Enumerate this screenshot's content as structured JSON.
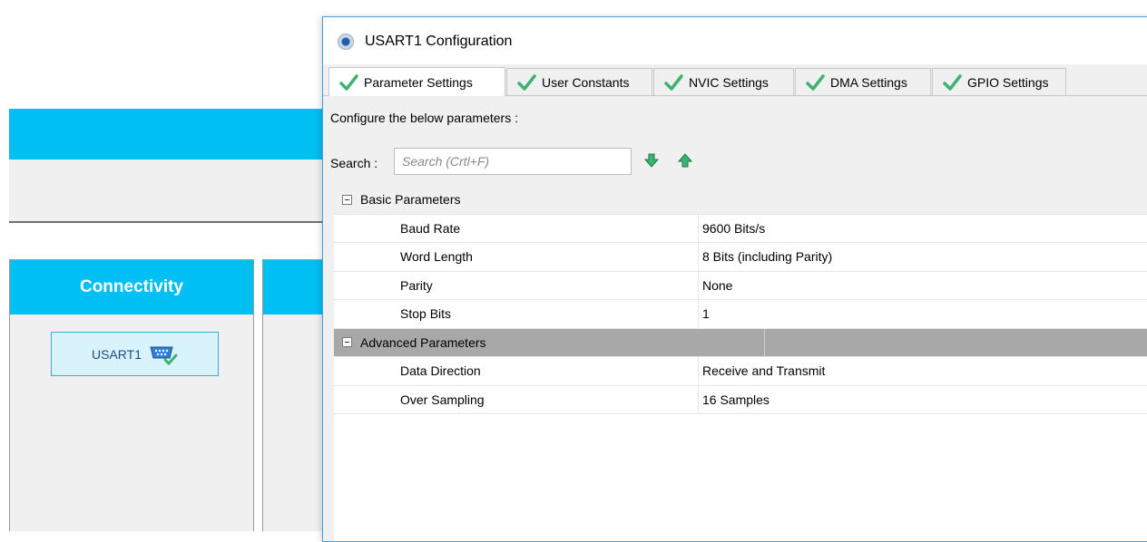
{
  "app": {
    "connectivity_header": "Connectivity",
    "usart_button_label": "USART1"
  },
  "dialog": {
    "title": "USART1 Configuration",
    "tabs": [
      {
        "label": "Parameter Settings",
        "active": true
      },
      {
        "label": "User Constants",
        "active": false
      },
      {
        "label": "NVIC Settings",
        "active": false
      },
      {
        "label": "DMA Settings",
        "active": false
      },
      {
        "label": "GPIO Settings",
        "active": false
      }
    ],
    "configure_text": "Configure the below parameters :",
    "search": {
      "label": "Search :",
      "placeholder": "Search (Crtl+F)",
      "value": ""
    },
    "sections": [
      {
        "title": "Basic Parameters",
        "params": [
          {
            "name": "Baud Rate",
            "value": "9600 Bits/s"
          },
          {
            "name": "Word Length",
            "value": "8 Bits (including Parity)"
          },
          {
            "name": "Parity",
            "value": "None"
          },
          {
            "name": "Stop Bits",
            "value": "1"
          }
        ]
      },
      {
        "title": "Advanced Parameters",
        "params": [
          {
            "name": "Data Direction",
            "value": "Receive and Transmit"
          },
          {
            "name": "Over Sampling",
            "value": "16 Samples"
          }
        ]
      }
    ]
  },
  "colors": {
    "accent": "#00bff3",
    "check_green": "#3cb371",
    "section_header": "#a8a8a8"
  },
  "icons": {
    "tab_status": "check-icon",
    "search_next": "arrow-down-icon",
    "search_prev": "arrow-up-icon",
    "usart": "serial-port-icon"
  }
}
